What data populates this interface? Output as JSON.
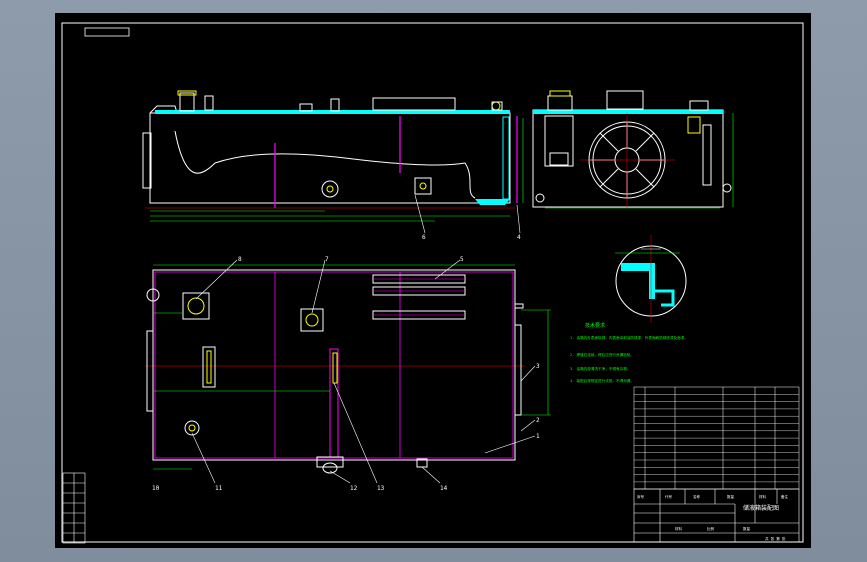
{
  "colors": {
    "background": "#8c9aa8",
    "sheet": "#000000",
    "line": "#ffffff",
    "cyan": "#00ffff",
    "magenta": "#ff00ff",
    "green": "#00ff00",
    "red": "#ff0000",
    "yellow": "#ffff00"
  },
  "drawing": {
    "title_text": "储液箱装配图",
    "callouts_top": [
      "6",
      "4"
    ],
    "callouts_plan": [
      "8",
      "7",
      "5",
      "3",
      "2",
      "1",
      "10",
      "11",
      "12",
      "13",
      "14"
    ],
    "technical_requirements_title": "技术要求",
    "technical_requirements": [
      "1. 油箱内外表面除锈，内表面涂耐油防锈漆，外表面刷防锈底漆及面漆。",
      "2. 焊缝应连续，焊后应进行渗漏检验。",
      "3. 油箱内部清洗干净，不得有杂物。",
      "4. 装配后按规定进行试验，不得渗漏。"
    ],
    "title_block": {
      "drawing_name": "储液箱装配图",
      "scale_label": "比例",
      "material_label": "材料",
      "qty_label": "数量",
      "sheet_label": "共 张 第 张"
    },
    "bom_headers": [
      "序号",
      "代号",
      "名称",
      "数量",
      "材料",
      "备注"
    ]
  }
}
